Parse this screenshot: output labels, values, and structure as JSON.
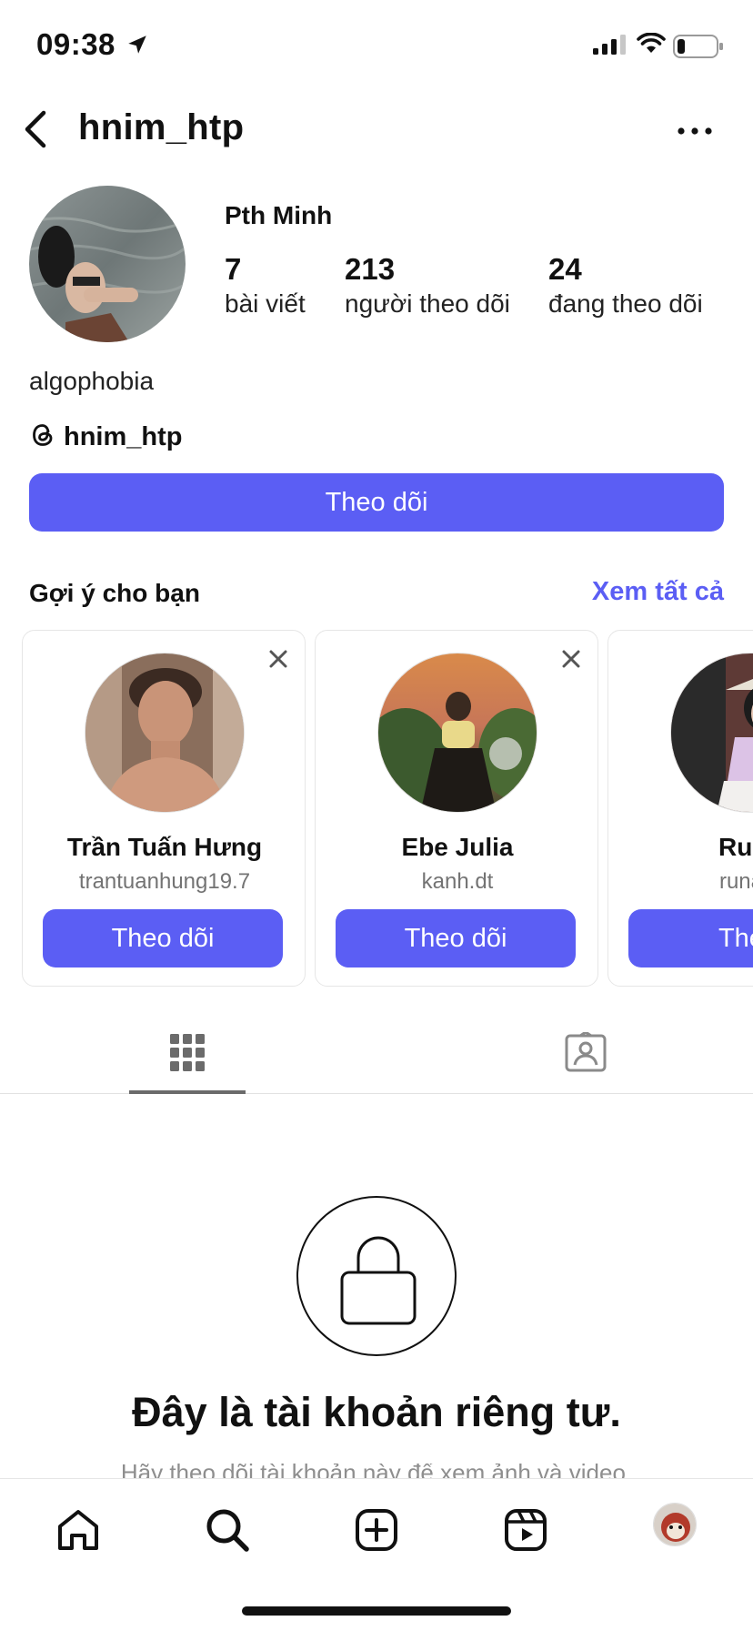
{
  "status_bar": {
    "time": "09:38"
  },
  "header": {
    "username": "hnim_htp"
  },
  "profile": {
    "display_name": "Pth Minh",
    "stats": [
      {
        "value": "7",
        "label": "bài viết"
      },
      {
        "value": "213",
        "label": "người theo dõi"
      },
      {
        "value": "24",
        "label": "đang theo dõi"
      }
    ],
    "bio": "algophobia",
    "threads_handle": "hnim_htp",
    "follow_label": "Theo dõi"
  },
  "suggestions": {
    "title": "Gợi ý cho bạn",
    "see_all": "Xem tất cả",
    "cards": [
      {
        "name": "Trần Tuấn Hưng",
        "handle": "trantuanhung19.7",
        "button": "Theo dõi"
      },
      {
        "name": "Ebe Julia",
        "handle": "kanh.dt",
        "button": "Theo dõi"
      },
      {
        "name": "Runa",
        "handle": "runa.g",
        "button": "Theo"
      }
    ]
  },
  "private": {
    "title": "Đây là tài khoản riêng tư.",
    "subtitle": "Hãy theo dõi tài khoản này để xem ảnh và video."
  },
  "colors": {
    "accent": "#5b5ef4"
  }
}
